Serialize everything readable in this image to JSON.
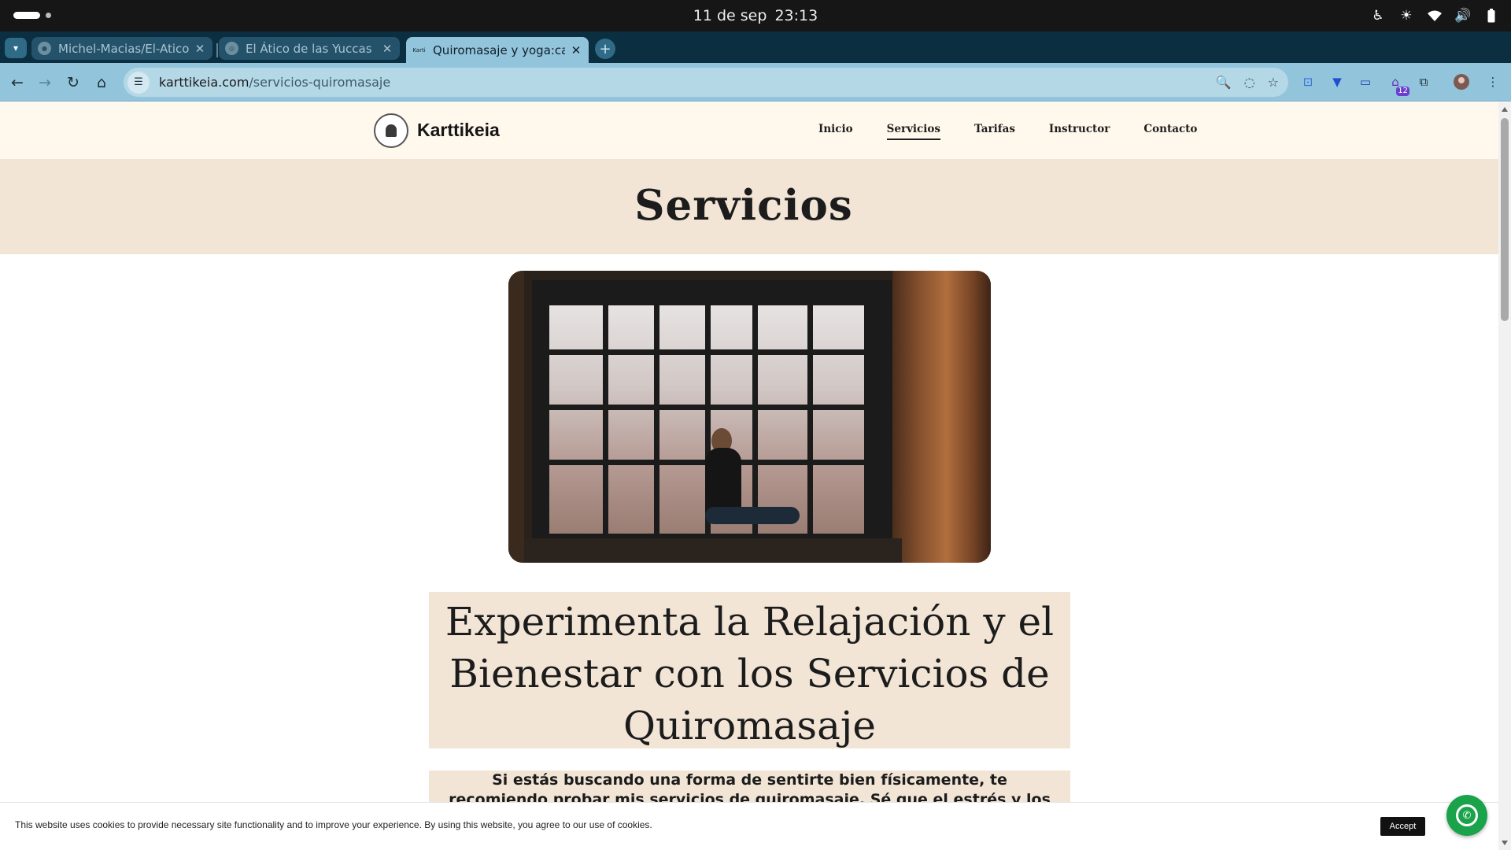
{
  "os": {
    "date": "11 de sep",
    "time": "23:13",
    "tray_icons": [
      "accessibility-icon",
      "brightness-icon",
      "wifi-icon",
      "volume-icon",
      "battery-icon"
    ]
  },
  "browser": {
    "tabs": [
      {
        "title": "Michel-Macias/El-Atico-",
        "favicon": "github-icon",
        "active": false
      },
      {
        "title": "El Ático de las Yuccas - Y",
        "favicon": "globe-icon",
        "active": false
      },
      {
        "title": "Quiromasaje y yoga:car",
        "favicon": "Karti",
        "active": true
      }
    ],
    "url_domain": "karttikeia.com",
    "url_path": "/servicios-quiromasaje",
    "extension_badge": "12"
  },
  "site": {
    "brand": "Karttikeia",
    "nav": [
      "Inicio",
      "Servicios",
      "Tarifas",
      "Instructor",
      "Contacto"
    ],
    "current_nav": "Servicios",
    "banner_title": "Servicios",
    "hero_image": "woman-stretching-by-window-photo",
    "headline": "Experimenta la Relajación y el Bienestar con los Servicios de Quiromasaje",
    "intro": "Si estás buscando una forma de sentirte bien físicamente, te recomiendo probar mis servicios de quiromasaje. Sé que el estrés y los dolores de"
  },
  "cookie": {
    "text": "This website uses cookies to provide necessary site functionality and to improve your experience. By using this website, you agree to our use of cookies.",
    "accept_label": "Accept"
  },
  "colors": {
    "tabstrip": "#0b2e40",
    "toolbar": "#92c4db",
    "header_bg": "#fff8ec",
    "banner_bg": "#f2e5d6",
    "whatsapp": "#1aa34a"
  }
}
